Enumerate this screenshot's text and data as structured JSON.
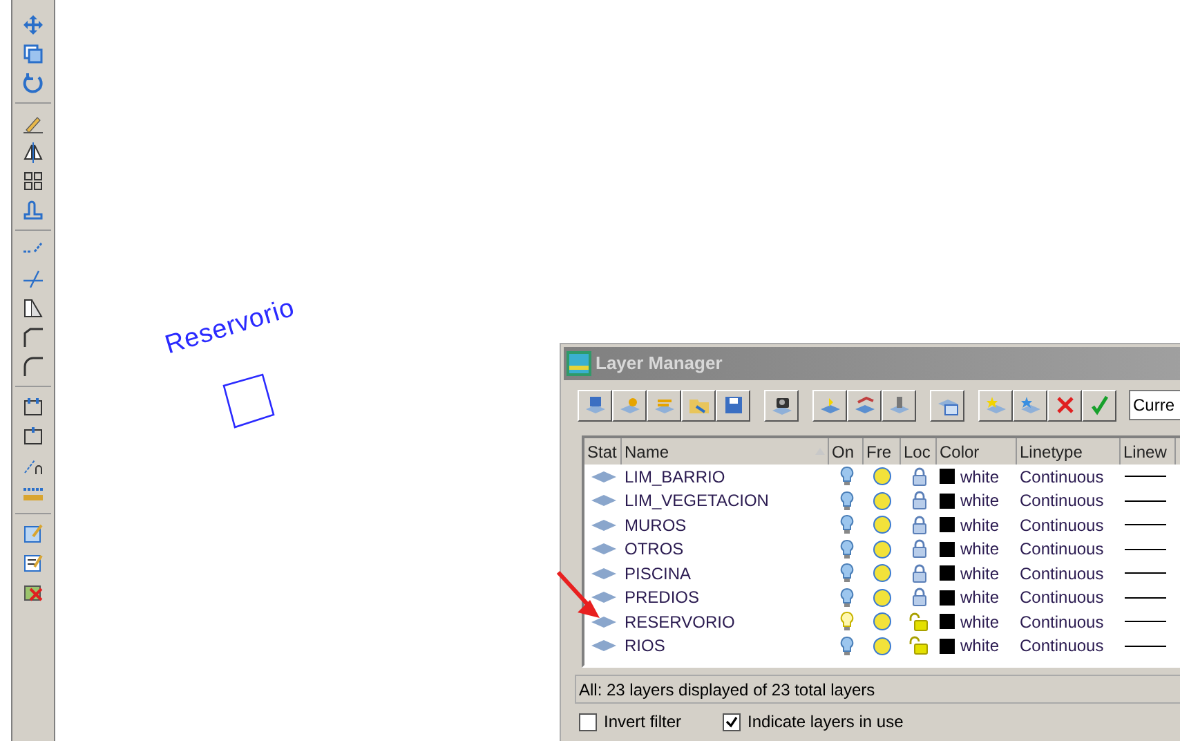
{
  "canvas": {
    "label": "Reservorio"
  },
  "dialog": {
    "title": "Layer Manager",
    "current_field": "Curre",
    "columns": [
      "Stat",
      "Name",
      "On",
      "Fre",
      "Loc",
      "Color",
      "Linetype",
      "Linew"
    ],
    "rows": [
      {
        "name": "LIM_BARRIO",
        "on": true,
        "locked": true,
        "color_label": "white",
        "linetype": "Continuous"
      },
      {
        "name": "LIM_VEGETACION",
        "on": true,
        "locked": true,
        "color_label": "white",
        "linetype": "Continuous"
      },
      {
        "name": "MUROS",
        "on": true,
        "locked": true,
        "color_label": "white",
        "linetype": "Continuous"
      },
      {
        "name": "OTROS",
        "on": true,
        "locked": true,
        "color_label": "white",
        "linetype": "Continuous"
      },
      {
        "name": "PISCINA",
        "on": true,
        "locked": true,
        "color_label": "white",
        "linetype": "Continuous"
      },
      {
        "name": "PREDIOS",
        "on": true,
        "locked": true,
        "color_label": "white",
        "linetype": "Continuous"
      },
      {
        "name": "RESERVORIO",
        "on": false,
        "locked": false,
        "color_label": "white",
        "linetype": "Continuous"
      },
      {
        "name": "RIOS",
        "on": true,
        "locked": false,
        "color_label": "white",
        "linetype": "Continuous"
      }
    ],
    "status": "All: 23 layers displayed of 23 total layers",
    "options": [
      {
        "label": "Invert filter",
        "checked": false
      },
      {
        "label": "Indicate layers in use",
        "checked": true
      }
    ]
  }
}
